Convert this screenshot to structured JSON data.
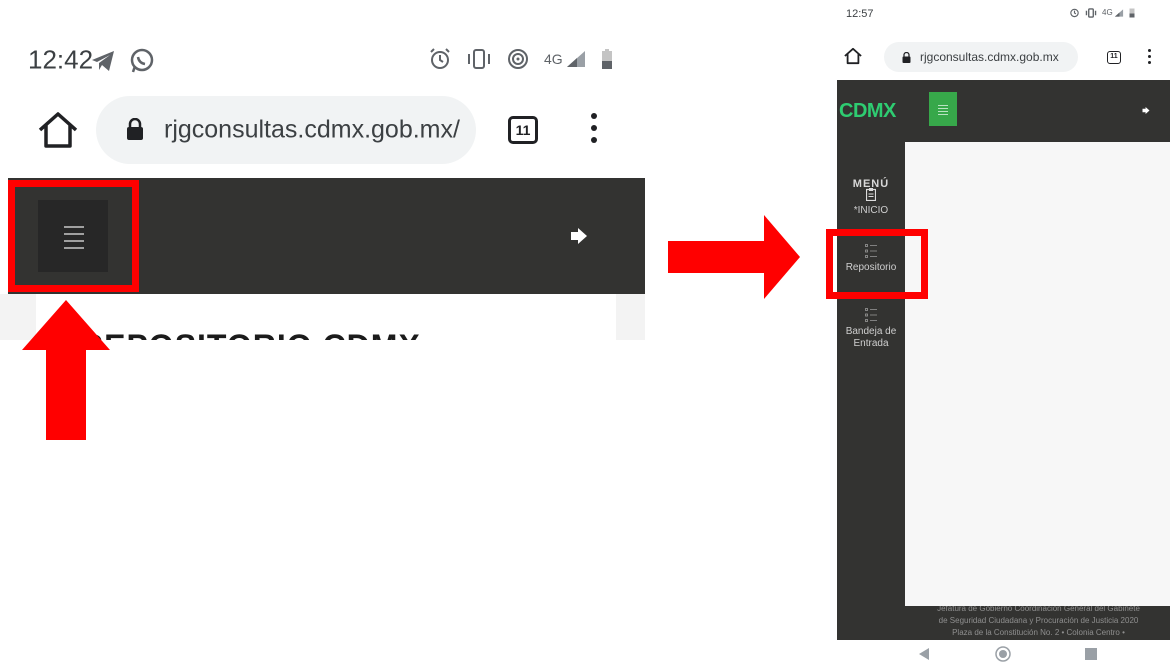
{
  "left_panel": {
    "status_bar": {
      "time": "12:42",
      "network": "4G"
    },
    "browser": {
      "url": "rjgconsultas.cdmx.gob.mx/",
      "tab_count": "11"
    },
    "page_heading": "REPOSITORIO CDMX"
  },
  "right_panel": {
    "status_bar": {
      "time": "12:57",
      "network": "4G"
    },
    "browser": {
      "url": "rjgconsultas.cdmx.gob.mx",
      "tab_count": "11"
    },
    "brand": "CDMX",
    "menu_title": "MENÚ",
    "nav_items": [
      {
        "label": "*INICIO",
        "icon": "clipboard-icon"
      },
      {
        "label": "Repositorio",
        "icon": "list-icon"
      },
      {
        "label_line1": "Bandeja de",
        "label_line2": "Entrada",
        "icon": "list-icon"
      }
    ],
    "footer_lines": [
      "Jefatura de Gobierno Coordinación General del Gabinete",
      "de Seguridad Ciudadana y Procuración de Justicia 2020",
      "Plaza de la Constitución No. 2 • Colonia Centro •"
    ]
  },
  "annotations": {
    "color": "#ff0000"
  },
  "colors": {
    "dark_bar": "#333331",
    "brand_green": "#2ecc71",
    "menu_button_green": "#37a84a"
  }
}
